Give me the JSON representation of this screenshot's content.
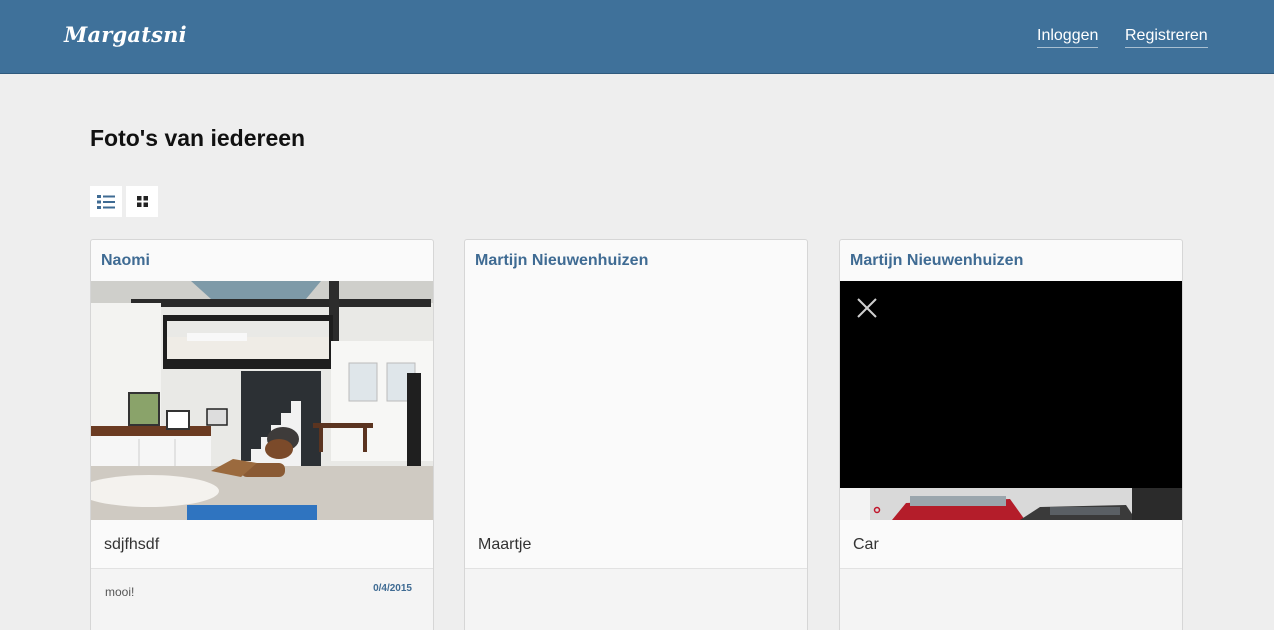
{
  "header": {
    "logo": "Margatsni",
    "login_label": "Inloggen",
    "register_label": "Registreren"
  },
  "page": {
    "title": "Foto's van iedereen"
  },
  "view_toggle": {
    "list_icon": "list-view-icon",
    "grid_icon": "grid-view-icon"
  },
  "photos": [
    {
      "author": "Naomi",
      "image": "loft-interior-photo",
      "caption": "sdjfhsdf",
      "comments": [
        {
          "text": "mooi!",
          "date": "0/4/2015"
        }
      ]
    },
    {
      "author": "Martijn Nieuwenhuizen",
      "image": "",
      "caption": "Maartje",
      "comments": []
    },
    {
      "author": "Martijn Nieuwenhuizen",
      "image": "car-video-player",
      "caption": "Car",
      "comments": []
    }
  ],
  "colors": {
    "header_bg": "#3f719a",
    "accent": "#3f6b93",
    "page_bg": "#eeeeee"
  }
}
